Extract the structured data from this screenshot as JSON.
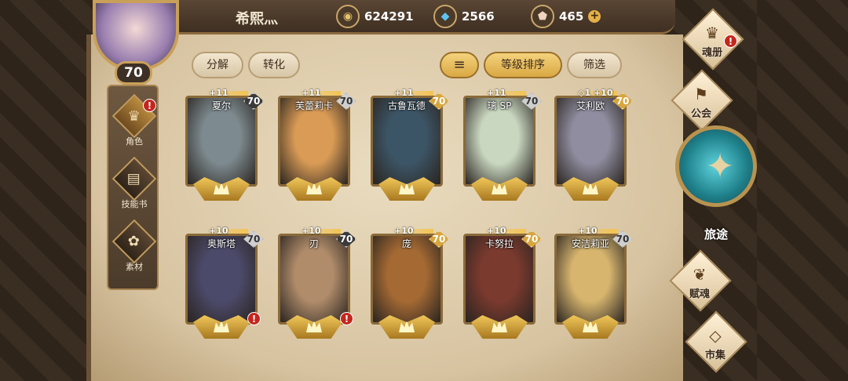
{
  "player": {
    "name": "希熙灬",
    "level": "70"
  },
  "currencies": [
    {
      "icon": "gold-coin-icon",
      "glyph": "◉",
      "value": "624291"
    },
    {
      "icon": "crystal-icon",
      "glyph": "◆",
      "value": "2566"
    },
    {
      "icon": "gem-icon",
      "glyph": "⬟",
      "value": "465",
      "plus": "+"
    }
  ],
  "toolbar": {
    "decompose": "分解",
    "convert": "转化",
    "sort_icon": "≡",
    "level_sort": "等级排序",
    "filter": "筛选"
  },
  "left_nav": [
    {
      "label": "角色",
      "icon": "helmet-icon",
      "glyph": "♛",
      "alert": "!"
    },
    {
      "label": "技能书",
      "icon": "skill-book-icon",
      "glyph": "▤"
    },
    {
      "label": "素材",
      "icon": "material-icon",
      "glyph": "✿"
    }
  ],
  "right_nav": [
    {
      "label": "魂册",
      "icon": "soul-book-icon",
      "glyph": "♛",
      "alert": "!"
    },
    {
      "label": "公会",
      "icon": "guild-icon",
      "glyph": "⚑"
    },
    {
      "label": "赋魂",
      "icon": "infuse-soul-icon",
      "glyph": "❦"
    },
    {
      "label": "市集",
      "icon": "market-icon",
      "glyph": "◇"
    }
  ],
  "journey": {
    "label": "旅途",
    "glyph": "✦"
  },
  "heroes": [
    {
      "name": "夏尔",
      "bonus": "+11",
      "level": "70",
      "lvstyle": "dark",
      "color": "#7d8a8f"
    },
    {
      "name": "芙蕾莉卡",
      "bonus": "+11",
      "level": "70",
      "lvstyle": "silver",
      "color": "#d99b55"
    },
    {
      "name": "古鲁瓦德",
      "bonus": "+11",
      "level": "70",
      "lvstyle": "gold",
      "color": "#3c5566"
    },
    {
      "name": "璃 SP",
      "bonus": "+11",
      "level": "70",
      "lvstyle": "silver",
      "color": "#c9d7c0"
    },
    {
      "name": "艾利欧",
      "bonus": "+10",
      "level": "70",
      "lvstyle": "gold",
      "prefix": "◇1",
      "color": "#8f8d9f"
    },
    {
      "name": "奥斯塔",
      "bonus": "+10",
      "level": "70",
      "lvstyle": "silver",
      "color": "#4c4a6a",
      "alert": "!"
    },
    {
      "name": "刃",
      "bonus": "+10",
      "level": "70",
      "lvstyle": "dark",
      "color": "#b08c6a",
      "alert": "!"
    },
    {
      "name": "庞",
      "bonus": "+10",
      "level": "70",
      "lvstyle": "gold",
      "color": "#a56a33"
    },
    {
      "name": "卡努拉",
      "bonus": "+10",
      "level": "70",
      "lvstyle": "gold",
      "color": "#7a3a2e"
    },
    {
      "name": "安洁莉亚",
      "bonus": "+10",
      "level": "70",
      "lvstyle": "silver",
      "color": "#d7b56e"
    }
  ],
  "colors": {
    "accent": "#d9a844",
    "alert": "#c4261d"
  }
}
